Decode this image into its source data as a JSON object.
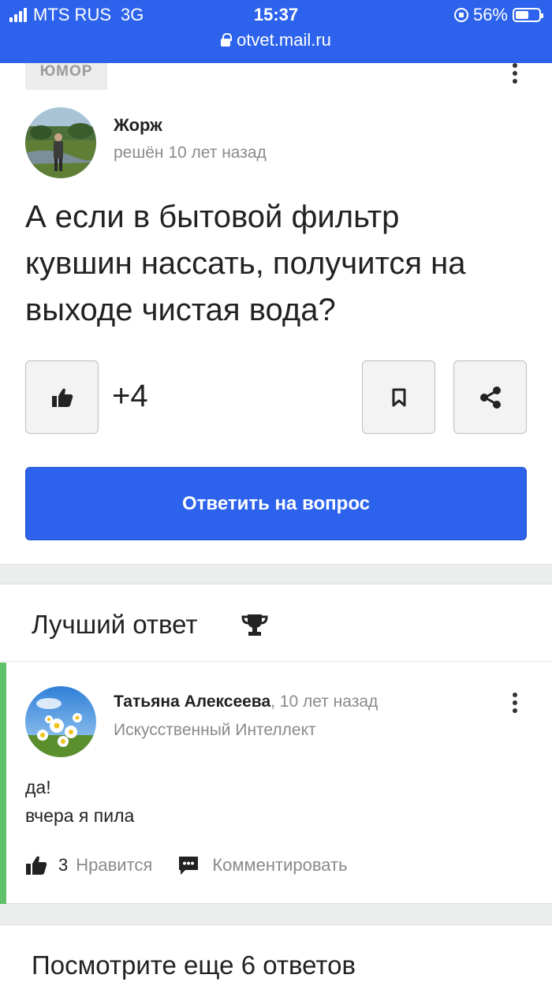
{
  "status_bar": {
    "carrier": "MTS RUS",
    "network": "3G",
    "time": "15:37",
    "battery": "56%",
    "battery_level": 0.56,
    "url": "otvet.mail.ru"
  },
  "question": {
    "category": "ЮМОР",
    "author_name": "Жорж",
    "author_meta": "решён 10 лет назад",
    "text": "А если в бытовой фильтр кувшин нассать, получится на выходе чистая вода?",
    "likes": "+4",
    "answer_button": "Ответить на вопрос"
  },
  "best_answer": {
    "title": "Лучший ответ",
    "author_name": "Татьяна Алексеева",
    "time": ", 10 лет назад",
    "author_rank": "Искусственный Интеллект",
    "text_line1": "да!",
    "text_line2": "вчера я пила",
    "likes_count": "3",
    "like_label": "Нравится",
    "comment_label": "Комментировать"
  },
  "more_answers": {
    "title": "Посмотрите еще 6 ответов"
  },
  "colors": {
    "accent": "#2d63ec",
    "best_answer_bar": "#5fc16a"
  },
  "icons": [
    "signal-icon",
    "rotation-lock-icon",
    "battery-icon",
    "padlock-icon",
    "kebab-menu-icon",
    "thumbs-up-icon",
    "bookmark-icon",
    "share-icon",
    "trophy-icon",
    "comment-icon"
  ]
}
